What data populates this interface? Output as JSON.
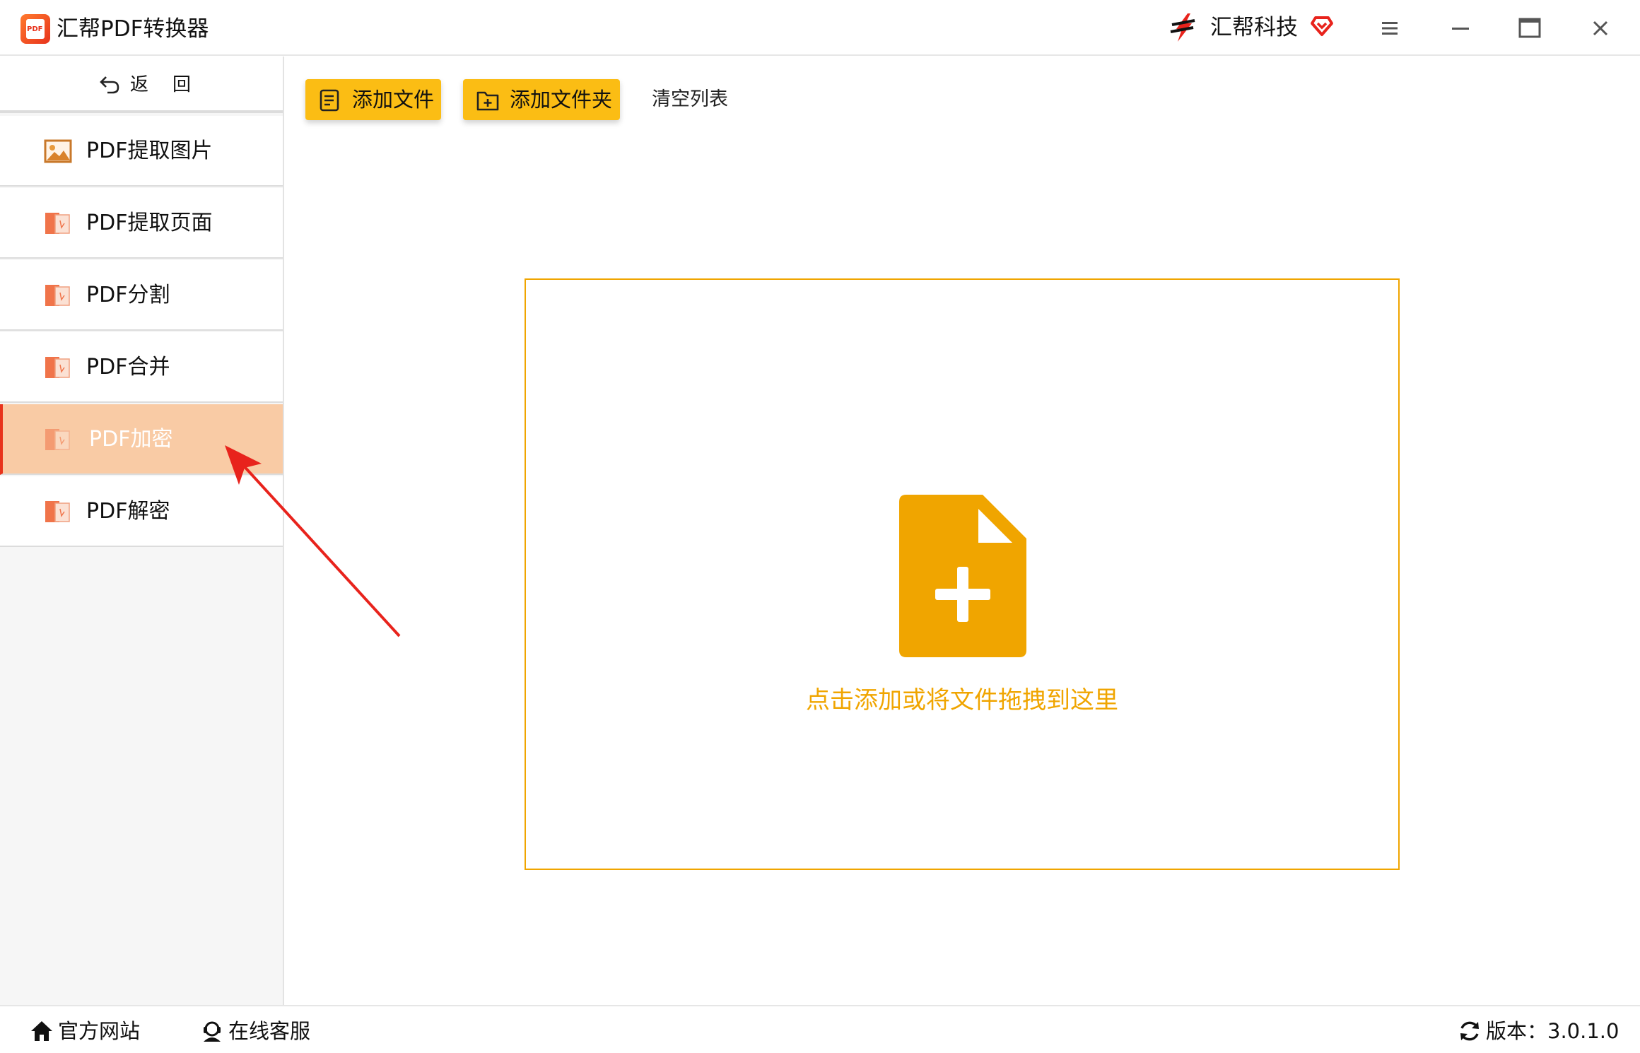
{
  "app": {
    "title": "汇帮PDF转换器",
    "logo_text": "PDF",
    "brand_name": "汇帮科技"
  },
  "colors": {
    "accent": "#fbbd14",
    "drop_border": "#f0a500",
    "active_bg": "#f9cba5",
    "active_marker": "#e8331c",
    "annotation_arrow": "#e8231c"
  },
  "window_controls": [
    "menu-icon",
    "minimize-icon",
    "maximize-icon",
    "close-icon"
  ],
  "sidebar": {
    "back_label": "返回",
    "items": [
      {
        "label": "PDF提取图片",
        "icon": "image-icon",
        "active": false
      },
      {
        "label": "PDF提取页面",
        "icon": "pdf-file-icon",
        "active": false
      },
      {
        "label": "PDF分割",
        "icon": "pdf-file-icon",
        "active": false
      },
      {
        "label": "PDF合并",
        "icon": "pdf-file-icon",
        "active": false
      },
      {
        "label": "PDF加密",
        "icon": "pdf-file-icon",
        "active": true
      },
      {
        "label": "PDF解密",
        "icon": "pdf-file-icon",
        "active": false
      }
    ]
  },
  "toolbar": {
    "add_file": "添加文件",
    "add_folder": "添加文件夹",
    "clear_list": "清空列表"
  },
  "dropzone": {
    "text": "点击添加或将文件拖拽到这里",
    "icon": "file-add-icon"
  },
  "footer": {
    "website": "官方网站",
    "service": "在线客服",
    "version": "版本：3.0.1.0"
  }
}
